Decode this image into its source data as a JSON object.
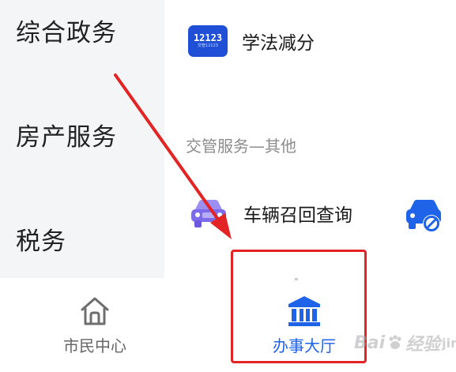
{
  "sidebar": {
    "items": [
      {
        "label": "综合政务"
      },
      {
        "label": "房产服务"
      },
      {
        "label": "税务"
      }
    ]
  },
  "content": {
    "rows": [
      {
        "label": "学法减分",
        "icon": "app-12123-icon",
        "icon_text": "12123",
        "icon_subtext": "交管12123"
      },
      {
        "label": "车辆召回查询",
        "icon": "car-recall-icon"
      }
    ],
    "section_title": "交管服务—其他"
  },
  "tabbar": {
    "tabs": [
      {
        "label": "市民中心",
        "icon": "house-icon",
        "active": false
      },
      {
        "label": "办事大厅",
        "icon": "government-hall-icon",
        "active": true
      }
    ]
  },
  "watermark": {
    "text_left": "Bai",
    "text_right": "经验",
    "text_small": "jingyan"
  },
  "colors": {
    "accent": "#1f63e8",
    "annotation": "#e32424",
    "sidebar_bg": "#f4f5f7",
    "app_icon_blue": "#1f4fd6",
    "recall_icon_purple": "#7c6bea"
  }
}
